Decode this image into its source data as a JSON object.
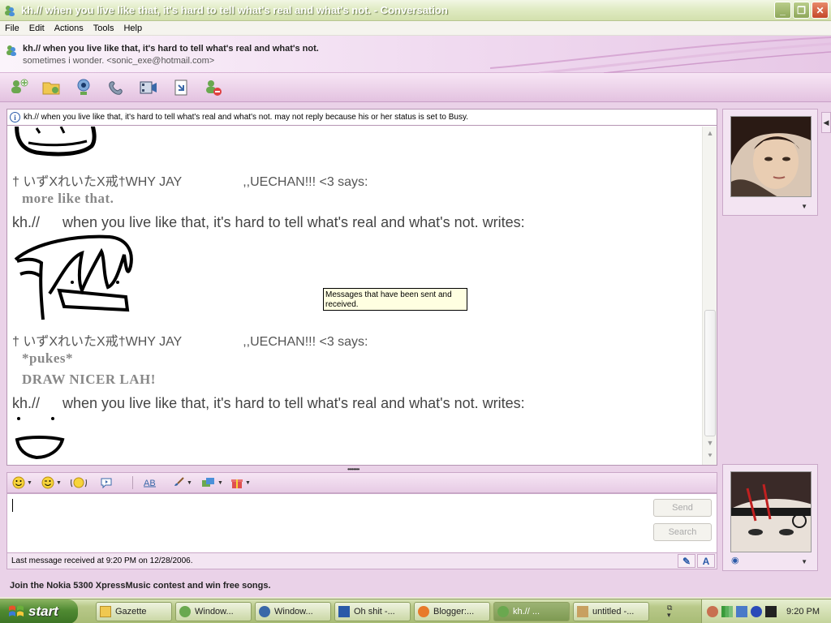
{
  "window": {
    "title": "kh.//      when you live like that, it's hard to tell what's real and what's not. - Conversation",
    "controls": [
      "_",
      "❐",
      "✕"
    ]
  },
  "menu": [
    "File",
    "Edit",
    "Actions",
    "Tools",
    "Help"
  ],
  "contact": {
    "name": "kh.//      when you live like that, it's hard to tell what's real and what's not.",
    "personal_message": "sometimes i wonder. <sonic_exe@hotmail.com>"
  },
  "toolbar": {
    "icons": [
      "invite-contact-icon",
      "send-files-icon",
      "webcam-icon",
      "call-icon",
      "video-icon",
      "share-icon",
      "block-icon"
    ]
  },
  "infobar": {
    "text": "kh.//      when you live like that, it's hard to tell what's real and what's not. may not reply because his or her status is set to Busy."
  },
  "messages": {
    "m1_sender_a": "† いずXれいたX戒†WHY JAY",
    "m1_sender_b": ",,UECHAN!!! <3 says:",
    "m1_text": "more like that.",
    "m2_writer_a": "kh.//",
    "m2_writer_b": "when you live like that, it's hard to tell what's real and what's not. writes:",
    "m3_sender_a": "† いずXれいたX戒†WHY JAY",
    "m3_sender_b": ",,UECHAN!!! <3 says:",
    "m3_text_1": "*pukes*",
    "m3_text_2": "DRAW NICER LAH!",
    "m4_writer_a": "kh.//",
    "m4_writer_b": "when you live like that, it's hard to tell what's real and what's not. writes:"
  },
  "tooltip": "Messages that have been sent and received.",
  "splitter": "••••••••",
  "compose": {
    "send_label": "Send",
    "search_label": "Search",
    "status": "Last message received at 9:20 PM on 12/28/2006.",
    "status_icons": [
      "handwriting-icon",
      "font-icon"
    ],
    "status_font_glyph": "A"
  },
  "ad": "Join the Nokia 5300 XpressMusic contest and win free songs.",
  "taskbar": {
    "start": "start",
    "tasks": [
      "Gazette",
      "Window...",
      "Window...",
      "Oh shit -...",
      "Blogger:...",
      "kh.//   ...",
      "untitled -..."
    ],
    "time": "9:20 PM"
  },
  "colors": {
    "accent": "#e3c2e0",
    "panel": "#ead2e8",
    "xp_olive": "#b9c98a"
  }
}
